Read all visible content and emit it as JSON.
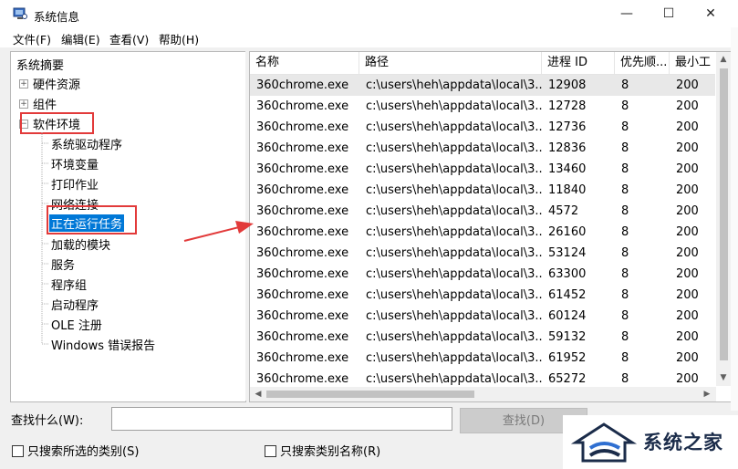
{
  "window": {
    "title": "系统信息",
    "minimize": "—",
    "maximize": "☐",
    "close": "✕"
  },
  "menu": [
    "文件(F)",
    "编辑(E)",
    "查看(V)",
    "帮助(H)"
  ],
  "tree": {
    "root": "系统摘要",
    "items": [
      {
        "label": "硬件资源",
        "expander": "+"
      },
      {
        "label": "组件",
        "expander": "+"
      },
      {
        "label": "软件环境",
        "expander": "−"
      }
    ],
    "children": [
      "系统驱动程序",
      "环境变量",
      "打印作业",
      "网络连接",
      "正在运行任务",
      "加载的模块",
      "服务",
      "程序组",
      "启动程序",
      "OLE 注册",
      "Windows 错误报告"
    ]
  },
  "table": {
    "columns": [
      "名称",
      "路径",
      "进程 ID",
      "优先顺...",
      "最小工"
    ],
    "rows": [
      [
        "360chrome.exe",
        "c:\\users\\heh\\appdata\\local\\3...",
        "12908",
        "8",
        "200"
      ],
      [
        "360chrome.exe",
        "c:\\users\\heh\\appdata\\local\\3...",
        "12728",
        "8",
        "200"
      ],
      [
        "360chrome.exe",
        "c:\\users\\heh\\appdata\\local\\3...",
        "12736",
        "8",
        "200"
      ],
      [
        "360chrome.exe",
        "c:\\users\\heh\\appdata\\local\\3...",
        "12836",
        "8",
        "200"
      ],
      [
        "360chrome.exe",
        "c:\\users\\heh\\appdata\\local\\3...",
        "13460",
        "8",
        "200"
      ],
      [
        "360chrome.exe",
        "c:\\users\\heh\\appdata\\local\\3...",
        "11840",
        "8",
        "200"
      ],
      [
        "360chrome.exe",
        "c:\\users\\heh\\appdata\\local\\3...",
        "4572",
        "8",
        "200"
      ],
      [
        "360chrome.exe",
        "c:\\users\\heh\\appdata\\local\\3...",
        "26160",
        "8",
        "200"
      ],
      [
        "360chrome.exe",
        "c:\\users\\heh\\appdata\\local\\3...",
        "53124",
        "8",
        "200"
      ],
      [
        "360chrome.exe",
        "c:\\users\\heh\\appdata\\local\\3...",
        "63300",
        "8",
        "200"
      ],
      [
        "360chrome.exe",
        "c:\\users\\heh\\appdata\\local\\3...",
        "61452",
        "8",
        "200"
      ],
      [
        "360chrome.exe",
        "c:\\users\\heh\\appdata\\local\\3...",
        "60124",
        "8",
        "200"
      ],
      [
        "360chrome.exe",
        "c:\\users\\heh\\appdata\\local\\3...",
        "59132",
        "8",
        "200"
      ],
      [
        "360chrome.exe",
        "c:\\users\\heh\\appdata\\local\\3...",
        "61952",
        "8",
        "200"
      ],
      [
        "360chrome.exe",
        "c:\\users\\heh\\appdata\\local\\3...",
        "65272",
        "8",
        "200"
      ]
    ]
  },
  "find": {
    "label": "查找什么(W):",
    "value": "",
    "button": "查找(D)",
    "check_selected": "只搜索所选的类别(S)",
    "check_names": "只搜索类别名称(R)"
  },
  "watermark": {
    "text": "系统之家"
  },
  "colors": {
    "selection": "#0078d7",
    "annotation": "#e23a3a"
  }
}
